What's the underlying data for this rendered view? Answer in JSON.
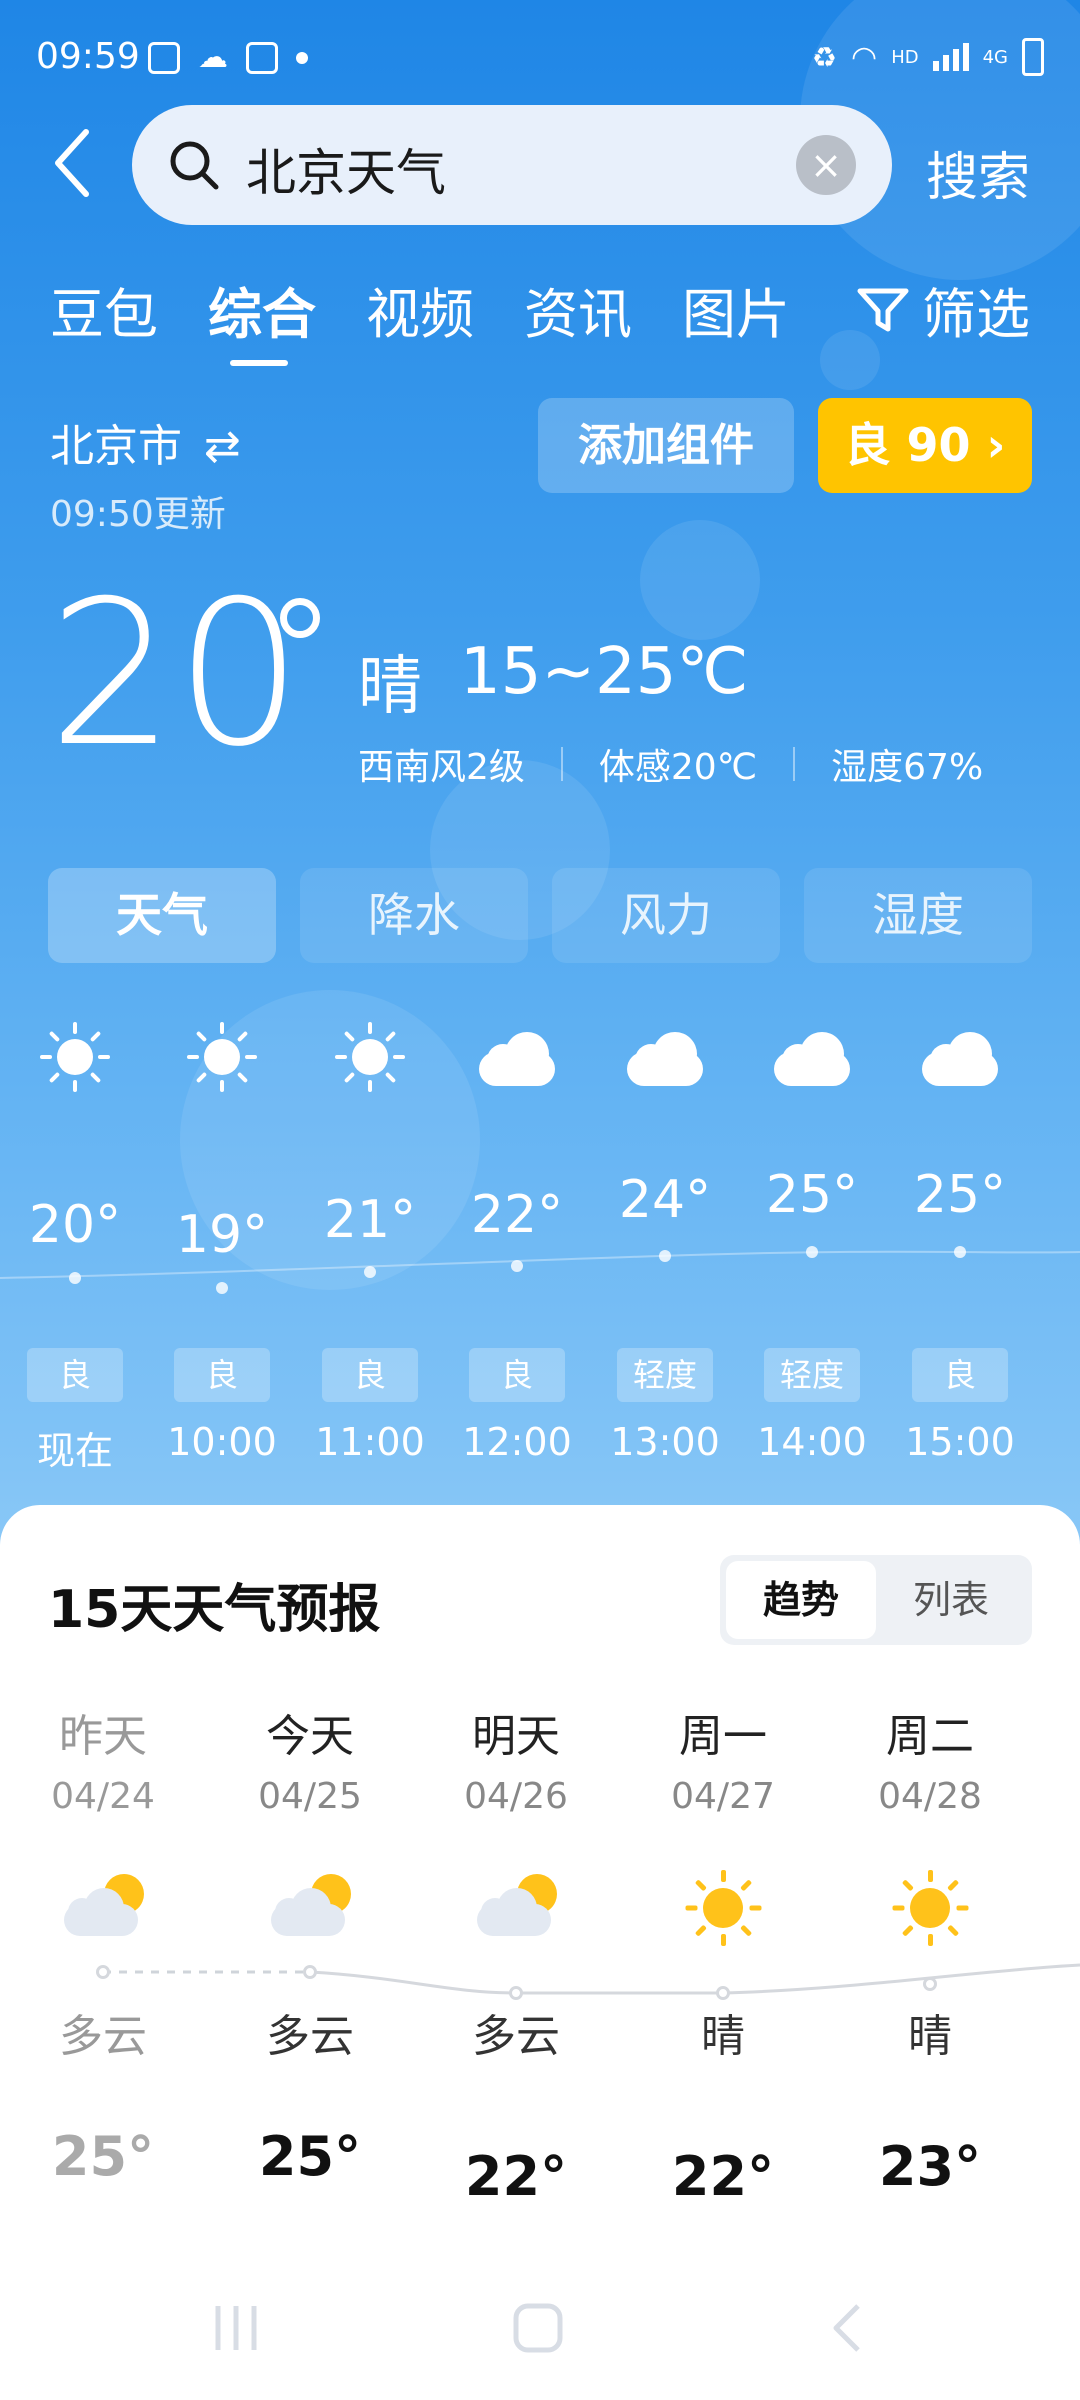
{
  "status_bar": {
    "time": "09:59",
    "network": "HD",
    "signal": "4G"
  },
  "search": {
    "query": "北京天气",
    "back_label": "‹",
    "clear_label": "×",
    "submit_label": "搜索"
  },
  "tabs": [
    {
      "label": "豆包",
      "active": false
    },
    {
      "label": "综合",
      "active": true
    },
    {
      "label": "视频",
      "active": false
    },
    {
      "label": "资讯",
      "active": false
    },
    {
      "label": "图片",
      "active": false
    }
  ],
  "filter_label": "筛选",
  "location": {
    "city": "北京市",
    "switch_icon": "⇄",
    "updated": "09:50更新"
  },
  "add_widget_label": "添加组件",
  "aqi_label": "良 90 ›",
  "aqi_color": "#ffc400",
  "current": {
    "temp": "20",
    "condition": "晴",
    "range": "15~25℃",
    "wind": "西南风2级",
    "feels_like": "体感20℃",
    "humidity": "湿度67%"
  },
  "segments": [
    {
      "label": "天气",
      "active": true
    },
    {
      "label": "降水",
      "active": false
    },
    {
      "label": "风力",
      "active": false
    },
    {
      "label": "湿度",
      "active": false
    }
  ],
  "hourly": [
    {
      "icon": "sun-icon",
      "temp": "20°",
      "quality": "良",
      "time": "现在"
    },
    {
      "icon": "sun-icon",
      "temp": "19°",
      "quality": "良",
      "time": "10:00"
    },
    {
      "icon": "sun-icon",
      "temp": "21°",
      "quality": "良",
      "time": "11:00"
    },
    {
      "icon": "cloud-icon",
      "temp": "22°",
      "quality": "良",
      "time": "12:00"
    },
    {
      "icon": "cloud-icon",
      "temp": "24°",
      "quality": "轻度",
      "time": "13:00"
    },
    {
      "icon": "cloud-icon",
      "temp": "25°",
      "quality": "轻度",
      "time": "14:00"
    },
    {
      "icon": "cloud-icon",
      "temp": "25°",
      "quality": "良",
      "time": "15:00"
    }
  ],
  "forecast": {
    "title": "15天天气预报",
    "toggle": {
      "trend": "趋势",
      "list": "列表"
    },
    "days": [
      {
        "name": "昨天",
        "date": "04/24",
        "icon": "partly-cloudy-icon",
        "condition": "多云",
        "high": "25°",
        "past": true
      },
      {
        "name": "今天",
        "date": "04/25",
        "icon": "partly-cloudy-icon",
        "condition": "多云",
        "high": "25°",
        "past": false
      },
      {
        "name": "明天",
        "date": "04/26",
        "icon": "partly-cloudy-icon",
        "condition": "多云",
        "high": "22°",
        "past": false
      },
      {
        "name": "周一",
        "date": "04/27",
        "icon": "sun-icon",
        "condition": "晴",
        "high": "22°",
        "past": false
      },
      {
        "name": "周二",
        "date": "04/28",
        "icon": "sun-icon",
        "condition": "晴",
        "high": "23°",
        "past": false
      }
    ]
  },
  "colors": {
    "sky_top": "#1f86e6",
    "sky_bottom": "#8ac8f7",
    "sun": "#ffc21a"
  }
}
